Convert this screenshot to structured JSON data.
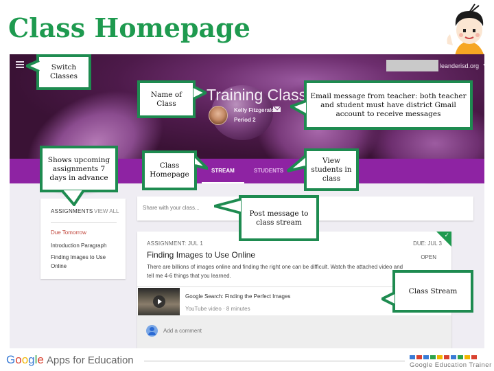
{
  "slide": {
    "title": "Class Homepage",
    "title_color": "#1e9a4f"
  },
  "classroom": {
    "account_domain": "leanderisd.org",
    "class_name": "Training Class",
    "teacher_name": "Kelly Fitzgerald",
    "section": "Period 2",
    "tabs": [
      {
        "label": "STREAM",
        "active": true
      },
      {
        "label": "STUDENTS",
        "active": false
      }
    ],
    "accent_color": "#8e23a3",
    "assignments_widget": {
      "heading": "ASSIGNMENTS",
      "view_all": "VIEW ALL",
      "due_label": "Due Tomorrow",
      "items": [
        "Introduction Paragraph",
        "Finding Images to Use Online"
      ]
    },
    "share_placeholder": "Share with your class...",
    "post": {
      "meta": "ASSIGNMENT: JUL 1",
      "due": "DUE: JUL 3",
      "title": "Finding Images to Use Online",
      "status": "OPEN",
      "body": "There are billions of images online and finding the right one can be difficult. Watch the attached video and tell me 4-6 things that you learned.",
      "attachment_title": "Google Search: Finding the Perfect Images",
      "attachment_meta": "YouTube video · 8 minutes",
      "comment_placeholder": "Add a comment"
    }
  },
  "callouts": {
    "switch_classes": "Switch Classes",
    "name_of_class": "Name of Class",
    "email_message": "Email message from teacher: both teacher and student must have district Gmail account to receive messages",
    "upcoming": "Shows upcoming assignments 7 days in advance",
    "class_homepage": "Class Homepage",
    "view_students": "View students in class",
    "post_message": "Post message to class stream",
    "class_stream": "Class Stream"
  },
  "footer": {
    "google_letters": [
      "G",
      "o",
      "o",
      "g",
      "l",
      "e"
    ],
    "apps_text": "Apps for Education",
    "trainer_text": "Google Education Trainer",
    "square_colors": [
      "#3a7bd5",
      "#d9412f",
      "#3a7bd5",
      "#2ea34b",
      "#f1b500",
      "#d9412f",
      "#3a7bd5",
      "#2ea34b",
      "#f1b500",
      "#d9412f"
    ]
  }
}
